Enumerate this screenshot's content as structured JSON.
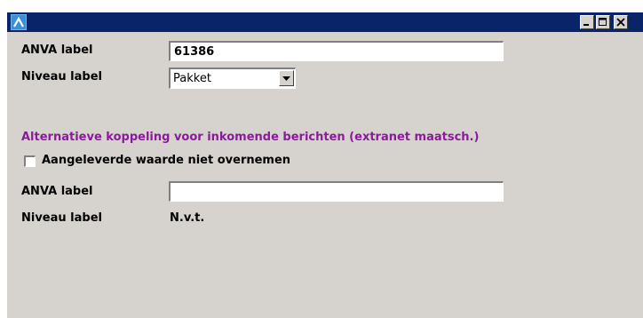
{
  "window": {
    "title": "",
    "controls": {
      "minimize_icon": "minimize-icon",
      "maximize_icon": "maximize-icon",
      "close_icon": "close-icon"
    }
  },
  "primary": {
    "anva_label": {
      "label": "ANVA label",
      "value": "61386"
    },
    "niveau_label": {
      "label": "Niveau label",
      "selected": "Pakket"
    }
  },
  "alternative": {
    "heading": "Alternatieve koppeling voor inkomende berichten (extranet maatsch.)",
    "checkbox_label": "Aangeleverde waarde niet overnemen",
    "checkbox_checked": false,
    "anva_label": {
      "label": "ANVA label",
      "value": ""
    },
    "niveau_label": {
      "label": "Niveau label",
      "value": "N.v.t."
    }
  },
  "colors": {
    "titlebar": "#0a246a",
    "window_bg": "#d6d3ce",
    "heading": "#8b1a9c"
  }
}
